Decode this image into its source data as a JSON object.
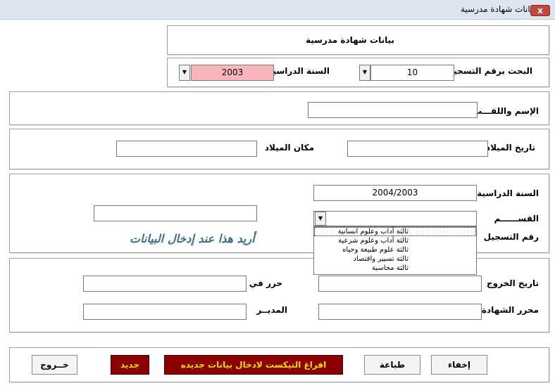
{
  "window": {
    "title": "بيانات شهادة مدرسية",
    "close_label": "x"
  },
  "header": {
    "title": "بيانات شهادة مدرسية"
  },
  "search": {
    "reg_label": "البحث برقم التسجيل",
    "reg_value": "10",
    "year_label": "السنة الدراسية",
    "year_value": "2003",
    "year_bg_color": "#f8b6bb"
  },
  "person": {
    "name_label": "الإسم واللقـــب",
    "name_value": "",
    "birthdate_label": "تاريخ الميلاد",
    "birthdate_value": "",
    "birthplace_label": "مكان الميلاد",
    "birthplace_value": ""
  },
  "school": {
    "year_label": "السنة الدراسية",
    "year_value": "2004/2003",
    "section_label": "القســــــم",
    "section_value": "",
    "reg_label": "رقم التسجيل",
    "reg_value": "",
    "note": "أريد هذا عند إدخال البيانات",
    "section_options": [
      "ثالثة آداب وعلوم انسانية",
      "ثالثة آداب وعلوم شرعية",
      "ثالثة علوم طبيعة وحياه",
      "ثالثة تسيير واقتصاد",
      "ثالثة محاسبة"
    ]
  },
  "certificate": {
    "exit_date_label": "تاريخ الخروج",
    "exit_date_value": "",
    "written_in_label": "حرر في",
    "written_in_value": "",
    "writer_label": "محرر الشهادة",
    "writer_value": "",
    "director_label": "المديــر",
    "director_value": ""
  },
  "footer": {
    "hide_label": "إخفاء",
    "print_label": "طباعة",
    "clear_label": "افراغ التيكست لادخال بيانات جديده",
    "new_label": "جديد",
    "exit_label": "خــروج"
  },
  "colors": {
    "accent_red": "#8b0000",
    "accent_yellow": "#ffe000",
    "note_color": "#3a6f8f"
  }
}
